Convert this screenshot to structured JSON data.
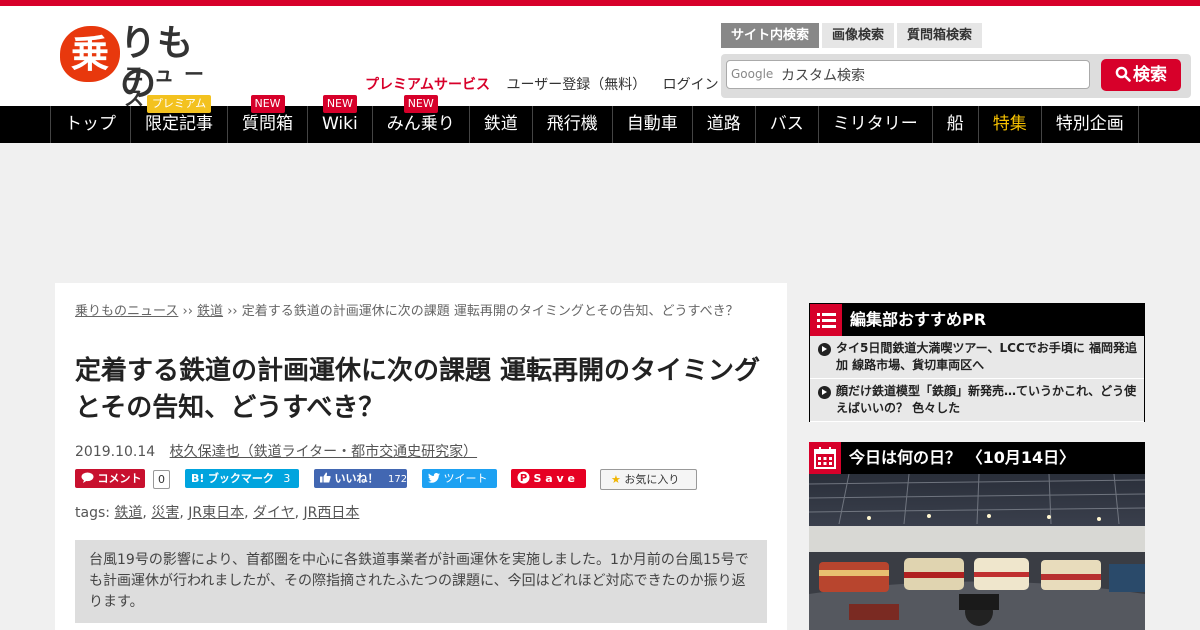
{
  "logo": {
    "kanji": "乗",
    "rimono": "りもの",
    "news": "ニュース"
  },
  "header": {
    "premium_label": "プレミアムサービス",
    "register_label": "ユーザー登録（無料）",
    "login_label": "ログイン"
  },
  "search": {
    "tabs": [
      "サイト内検索",
      "画像検索",
      "質問箱検索"
    ],
    "google_mark": "Google",
    "placeholder": "カスタム検索",
    "button_label": "検索"
  },
  "nav": {
    "items": [
      {
        "label": "トップ"
      },
      {
        "label": "限定記事",
        "badge": "プレミアム"
      },
      {
        "label": "質問箱",
        "badge": "NEW"
      },
      {
        "label": "Wiki",
        "badge": "NEW"
      },
      {
        "label": "みん乗り",
        "badge": "NEW"
      },
      {
        "label": "鉄道"
      },
      {
        "label": "飛行機"
      },
      {
        "label": "自動車"
      },
      {
        "label": "道路"
      },
      {
        "label": "バス"
      },
      {
        "label": "ミリタリー"
      },
      {
        "label": "船"
      },
      {
        "label": "特集"
      },
      {
        "label": "特別企画"
      }
    ]
  },
  "article": {
    "breadcrumb": {
      "home": "乗りものニュース",
      "sep": "››",
      "category": "鉄道",
      "current": "定着する鉄道の計画運休に次の課題 運転再開のタイミングとその告知、どうすべき？"
    },
    "title": "定着する鉄道の計画運休に次の課題 運転再開のタイミングとその告知、どうすべき？",
    "date": "2019.10.14",
    "author": "枝久保達也（鉄道ライター・都市交通史研究家）",
    "social": {
      "comment_label": "コメント",
      "comment_count": "0",
      "hatena_label": "ブックマーク",
      "hatena_count": "3",
      "like_label": "いいね！",
      "like_count": "172",
      "tweet_label": "ツイート",
      "save_label": "S a v e",
      "fav_label": "お気に入り"
    },
    "tags_prefix": "tags:",
    "tags": [
      "鉄道",
      "災害",
      "JR東日本",
      "ダイヤ",
      "JR西日本"
    ],
    "summary": "台風19号の影響により、首都圏を中心に各鉄道事業者が計画運休を実施しました。1か月前の台風15号でも計画運休が行われましたが、その際指摘されたふたつの課題に、今回はどれほど対応できたのか振り返ります。"
  },
  "sidebar": {
    "pr_title": "編集部おすすめPR",
    "pr_items": [
      "タイ5日間鉄道大満喫ツアー、LCCでお手頃に 福岡発追加 線路市場、貨切車両区へ",
      "顔だけ鉄道模型「鉄顔」新発売…ていうかこれ、どう使えばいいの？ 色々した"
    ],
    "today_title": "今日は何の日？ 〈10月14日〉"
  },
  "colors": {
    "brand_red": "#d7002a",
    "nav_bg": "#000000",
    "special_yellow": "#f5c000"
  }
}
